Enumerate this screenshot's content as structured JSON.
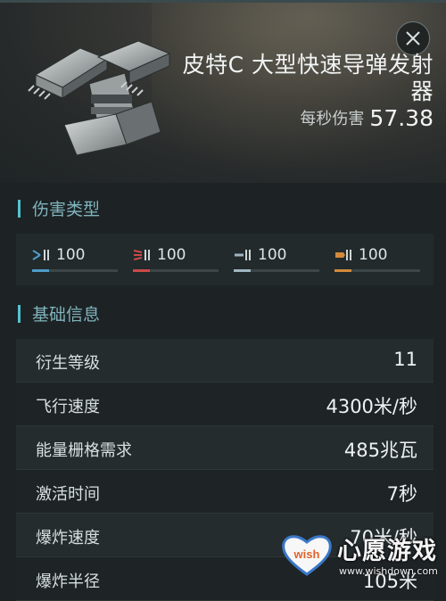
{
  "module": {
    "title": "皮特C 大型快速导弹发射器",
    "dps_label": "每秒伤害",
    "dps_value": "57.38"
  },
  "sections": {
    "damage_type": "伤害类型",
    "basic_info": "基础信息"
  },
  "damage": [
    {
      "value": "100",
      "icon": "em-damage-icon",
      "color": "#4e9cc8",
      "fill": 0.2
    },
    {
      "value": "100",
      "icon": "thermal-damage-icon",
      "color": "#c94b48",
      "fill": 0.2
    },
    {
      "value": "100",
      "icon": "kinetic-damage-icon",
      "color": "#9fb6c2",
      "fill": 0.2
    },
    {
      "value": "100",
      "icon": "explosive-damage-icon",
      "color": "#d18a3c",
      "fill": 0.2
    }
  ],
  "info": [
    {
      "label": "衍生等级",
      "value": "11"
    },
    {
      "label": "飞行速度",
      "value": "4300米/秒"
    },
    {
      "label": "能量栅格需求",
      "value": "485兆瓦"
    },
    {
      "label": "激活时间",
      "value": "7秒"
    },
    {
      "label": "爆炸速度",
      "value": "70米/秒"
    },
    {
      "label": "爆炸半径",
      "value": "105米"
    }
  ],
  "watermark": {
    "brand": "心愿游戏",
    "url": "www.wishdown.com",
    "heart_text": "wish"
  }
}
